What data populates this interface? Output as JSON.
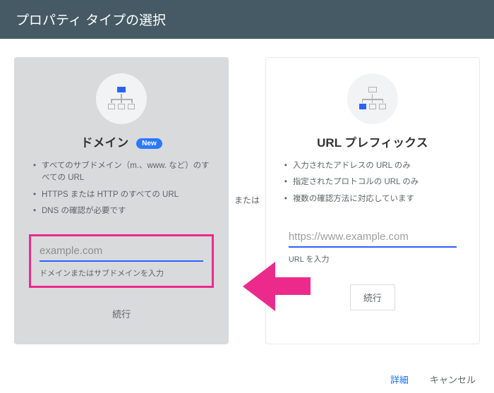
{
  "header": {
    "title": "プロパティ タイプの選択"
  },
  "divider": {
    "label": "または"
  },
  "domainCard": {
    "title": "ドメイン",
    "badge": "New",
    "features": [
      "すべてのサブドメイン（m.、www. など）のすべての URL",
      "HTTPS または HTTP のすべての URL",
      "DNS の確認が必要です"
    ],
    "input": {
      "value": "example.com",
      "hint": "ドメインまたはサブドメインを入力"
    },
    "continue": "続行"
  },
  "urlCard": {
    "title": "URL プレフィックス",
    "features": [
      "入力されたアドレスの URL のみ",
      "指定されたプロトコルの URL のみ",
      "複数の確認方法に対応しています"
    ],
    "input": {
      "value": "https://www.example.com",
      "hint": "URL を入力"
    },
    "continue": "続行"
  },
  "footer": {
    "more": "詳細",
    "cancel": "キャンセル"
  }
}
